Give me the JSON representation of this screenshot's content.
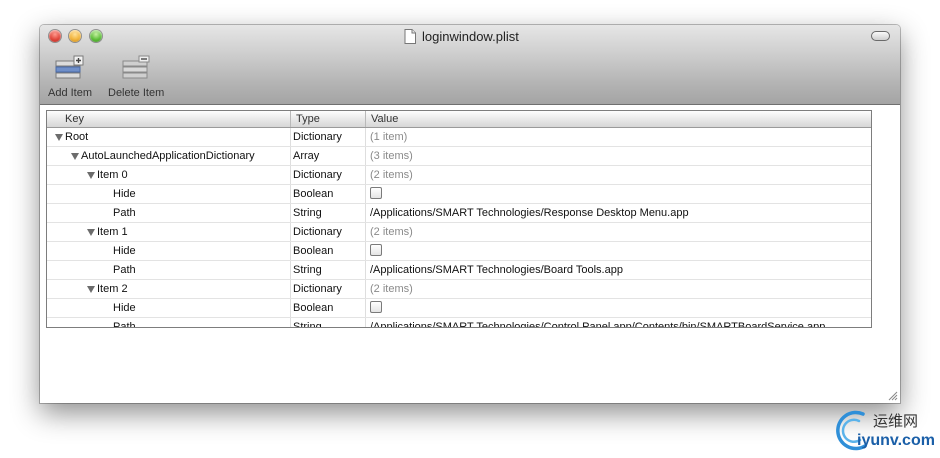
{
  "window": {
    "title": "loginwindow.plist"
  },
  "toolbar": {
    "add_item": {
      "label": "Add Item",
      "icon": "add-item-icon"
    },
    "delete_item": {
      "label": "Delete Item",
      "icon": "delete-item-icon"
    }
  },
  "table": {
    "columns": [
      "Key",
      "Type",
      "Value"
    ],
    "rows": [
      {
        "key": "Root",
        "type": "Dictionary",
        "value": "(1 item)",
        "depth": 0,
        "expanded": true,
        "summary": true
      },
      {
        "key": "AutoLaunchedApplicationDictionary",
        "type": "Array",
        "value": "(3 items)",
        "depth": 1,
        "expanded": true,
        "summary": true
      },
      {
        "key": "Item 0",
        "type": "Dictionary",
        "value": "(2 items)",
        "depth": 2,
        "expanded": true,
        "summary": true
      },
      {
        "key": "Hide",
        "type": "Boolean",
        "value": false,
        "depth": 3,
        "checkbox": true
      },
      {
        "key": "Path",
        "type": "String",
        "value": "/Applications/SMART Technologies/Response Desktop Menu.app",
        "depth": 3
      },
      {
        "key": "Item 1",
        "type": "Dictionary",
        "value": "(2 items)",
        "depth": 2,
        "expanded": true,
        "summary": true
      },
      {
        "key": "Hide",
        "type": "Boolean",
        "value": false,
        "depth": 3,
        "checkbox": true
      },
      {
        "key": "Path",
        "type": "String",
        "value": "/Applications/SMART Technologies/Board Tools.app",
        "depth": 3
      },
      {
        "key": "Item 2",
        "type": "Dictionary",
        "value": "(2 items)",
        "depth": 2,
        "expanded": true,
        "summary": true
      },
      {
        "key": "Hide",
        "type": "Boolean",
        "value": false,
        "depth": 3,
        "checkbox": true
      },
      {
        "key": "Path",
        "type": "String",
        "value": "/Applications/SMART Technologies/Control Panel.app/Contents/bin/SMARTBoardService.app",
        "depth": 3
      }
    ]
  },
  "watermark": {
    "name": "运维网",
    "url": "iyunv.com"
  }
}
